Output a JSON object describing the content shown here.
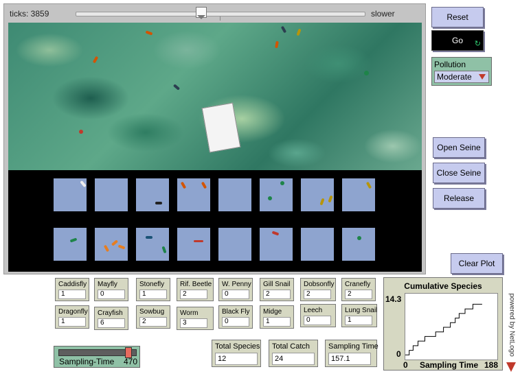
{
  "header": {
    "ticks_text": "ticks: 3859",
    "speed_label": "slower"
  },
  "buttons": {
    "reset": "Reset",
    "go": "Go",
    "open_seine": "Open Seine",
    "close_seine": "Close Seine",
    "release": "Release",
    "clear_plot": "Clear Plot"
  },
  "pollution": {
    "label": "Pollution",
    "value": "Moderate"
  },
  "monitors": [
    {
      "label": "Caddisfly",
      "value": "1"
    },
    {
      "label": "Mayfly",
      "value": "0"
    },
    {
      "label": "Stonefly",
      "value": "1"
    },
    {
      "label": "Rif. Beetle",
      "value": "2"
    },
    {
      "label": "W. Penny",
      "value": "0"
    },
    {
      "label": "Gill Snail",
      "value": "2"
    },
    {
      "label": "Dobsonfly",
      "value": "2"
    },
    {
      "label": "Cranefly",
      "value": "2"
    },
    {
      "label": "Dragonfly",
      "value": "1"
    },
    {
      "label": "Crayfish",
      "value": "6"
    },
    {
      "label": "Sowbug",
      "value": "2"
    },
    {
      "label": "Worm",
      "value": "3"
    },
    {
      "label": "Black Fly",
      "value": "0"
    },
    {
      "label": "Midge",
      "value": "1"
    },
    {
      "label": "Leech",
      "value": "0"
    },
    {
      "label": "Lung Snail",
      "value": "1"
    }
  ],
  "totals": [
    {
      "label": "Total Species",
      "value": "12"
    },
    {
      "label": "Total Catch",
      "value": "24"
    },
    {
      "label": "Sampling Time",
      "value": "157.1"
    }
  ],
  "sampling_slider": {
    "label": "Sampling-Time",
    "value": "470",
    "level_fraction": 0.93
  },
  "plot": {
    "title": "Cumulative Species",
    "y_max_label": "14.3",
    "y_min_label": "0",
    "x_min_label": "0",
    "x_max_label": "188",
    "x_label": "Sampling Time"
  },
  "chart_data": {
    "type": "line",
    "title": "Cumulative Species",
    "xlabel": "Sampling Time",
    "ylabel": "",
    "xlim": [
      0,
      188
    ],
    "ylim": [
      0,
      14.3
    ],
    "series": [
      {
        "name": "",
        "x": [
          0,
          8,
          8,
          16,
          16,
          26,
          26,
          40,
          40,
          62,
          62,
          78,
          78,
          92,
          92,
          102,
          102,
          110,
          110,
          122,
          122,
          138,
          138,
          157
        ],
        "y": [
          1,
          1,
          2,
          2,
          3,
          3,
          4,
          4,
          5,
          5,
          6,
          6,
          7,
          7,
          8,
          8,
          9,
          9,
          10,
          10,
          11,
          11,
          12,
          12
        ]
      }
    ]
  },
  "branding": {
    "powered_by": "powered by NetLogo"
  },
  "colors": {
    "button_bg": "#c6cbee",
    "monitor_bg": "#d6d8c2",
    "chooser_bg": "#8fc1a6",
    "tray_bg": "#8ea4cf"
  }
}
